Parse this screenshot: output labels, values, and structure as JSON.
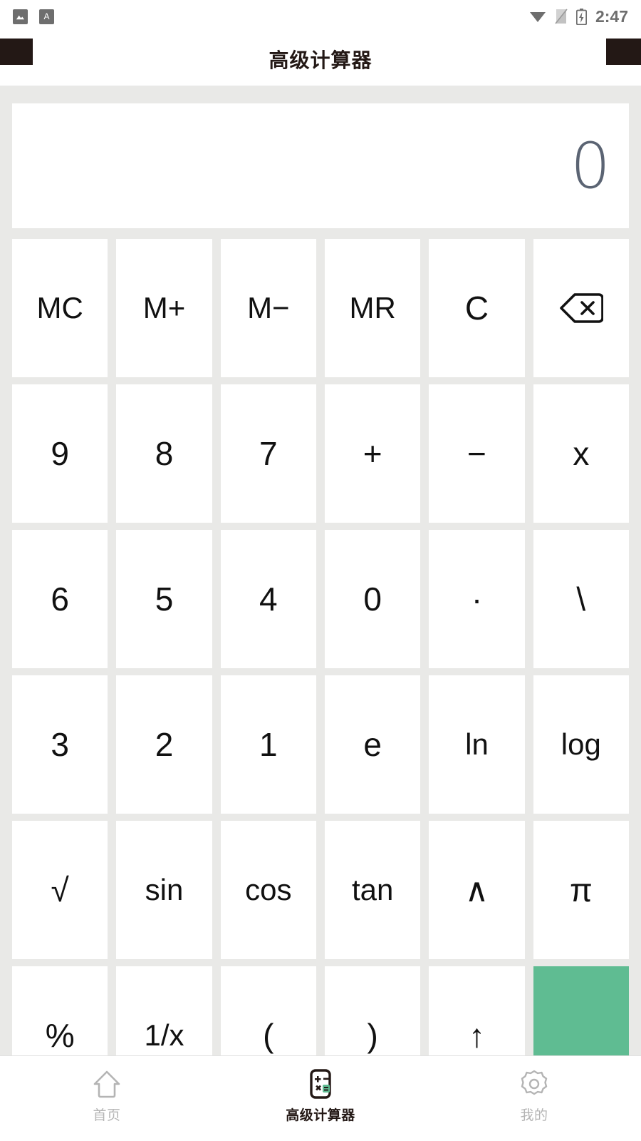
{
  "status_bar": {
    "left_icons": [
      {
        "name": "screenshot-icon",
        "glyph": "image"
      },
      {
        "name": "font-size-icon",
        "glyph": "A"
      }
    ],
    "right_icons": [
      {
        "name": "wifi-icon"
      },
      {
        "name": "sim-card-off-icon"
      },
      {
        "name": "battery-charging-icon"
      }
    ],
    "time": "2:47"
  },
  "header": {
    "title": "高级计算器"
  },
  "display": {
    "value": "0",
    "text_color": "#5b6473"
  },
  "keypad": {
    "rows": [
      [
        {
          "label": "MC",
          "name": "key-memory-clear",
          "type": "text"
        },
        {
          "label": "M+",
          "name": "key-memory-add",
          "type": "text"
        },
        {
          "label": "M−",
          "name": "key-memory-sub",
          "type": "text"
        },
        {
          "label": "MR",
          "name": "key-memory-recall",
          "type": "text"
        },
        {
          "label": "C",
          "name": "key-clear",
          "type": "text"
        },
        {
          "label": "",
          "name": "key-backspace",
          "type": "icon",
          "icon": "backspace-icon"
        }
      ],
      [
        {
          "label": "9",
          "name": "key-9",
          "type": "text"
        },
        {
          "label": "8",
          "name": "key-8",
          "type": "text"
        },
        {
          "label": "7",
          "name": "key-7",
          "type": "text"
        },
        {
          "label": "+",
          "name": "key-plus",
          "type": "text"
        },
        {
          "label": "−",
          "name": "key-minus",
          "type": "text"
        },
        {
          "label": "x",
          "name": "key-multiply",
          "type": "text"
        }
      ],
      [
        {
          "label": "6",
          "name": "key-6",
          "type": "text"
        },
        {
          "label": "5",
          "name": "key-5",
          "type": "text"
        },
        {
          "label": "4",
          "name": "key-4",
          "type": "text"
        },
        {
          "label": "0",
          "name": "key-0",
          "type": "text"
        },
        {
          "label": "·",
          "name": "key-decimal",
          "type": "text"
        },
        {
          "label": "\\",
          "name": "key-divide",
          "type": "text"
        }
      ],
      [
        {
          "label": "3",
          "name": "key-3",
          "type": "text"
        },
        {
          "label": "2",
          "name": "key-2",
          "type": "text"
        },
        {
          "label": "1",
          "name": "key-1",
          "type": "text"
        },
        {
          "label": "e",
          "name": "key-e",
          "type": "text"
        },
        {
          "label": "ln",
          "name": "key-ln",
          "type": "text"
        },
        {
          "label": "log",
          "name": "key-log",
          "type": "text"
        }
      ],
      [
        {
          "label": "√",
          "name": "key-sqrt",
          "type": "text"
        },
        {
          "label": "sin",
          "name": "key-sin",
          "type": "text"
        },
        {
          "label": "cos",
          "name": "key-cos",
          "type": "text"
        },
        {
          "label": "tan",
          "name": "key-tan",
          "type": "text"
        },
        {
          "label": "∧",
          "name": "key-power",
          "type": "text"
        },
        {
          "label": "π",
          "name": "key-pi",
          "type": "text"
        }
      ],
      [
        {
          "label": "%",
          "name": "key-percent",
          "type": "text"
        },
        {
          "label": "1/x",
          "name": "key-reciprocal",
          "type": "text"
        },
        {
          "label": "(",
          "name": "key-paren-open",
          "type": "text"
        },
        {
          "label": ")",
          "name": "key-paren-close",
          "type": "text"
        },
        {
          "label": "↑",
          "name": "key-up",
          "type": "text"
        },
        {
          "label": "",
          "name": "key-equals",
          "type": "equals"
        }
      ]
    ],
    "equals_color": "#5fbc92"
  },
  "bottom_nav": {
    "items": [
      {
        "label": "首页",
        "name": "nav-home",
        "icon": "home-icon",
        "active": false
      },
      {
        "label": "高级计算器",
        "name": "nav-calculator",
        "icon": "calculator-icon",
        "active": true
      },
      {
        "label": "我的",
        "name": "nav-profile",
        "icon": "gear-icon",
        "active": false
      }
    ]
  }
}
